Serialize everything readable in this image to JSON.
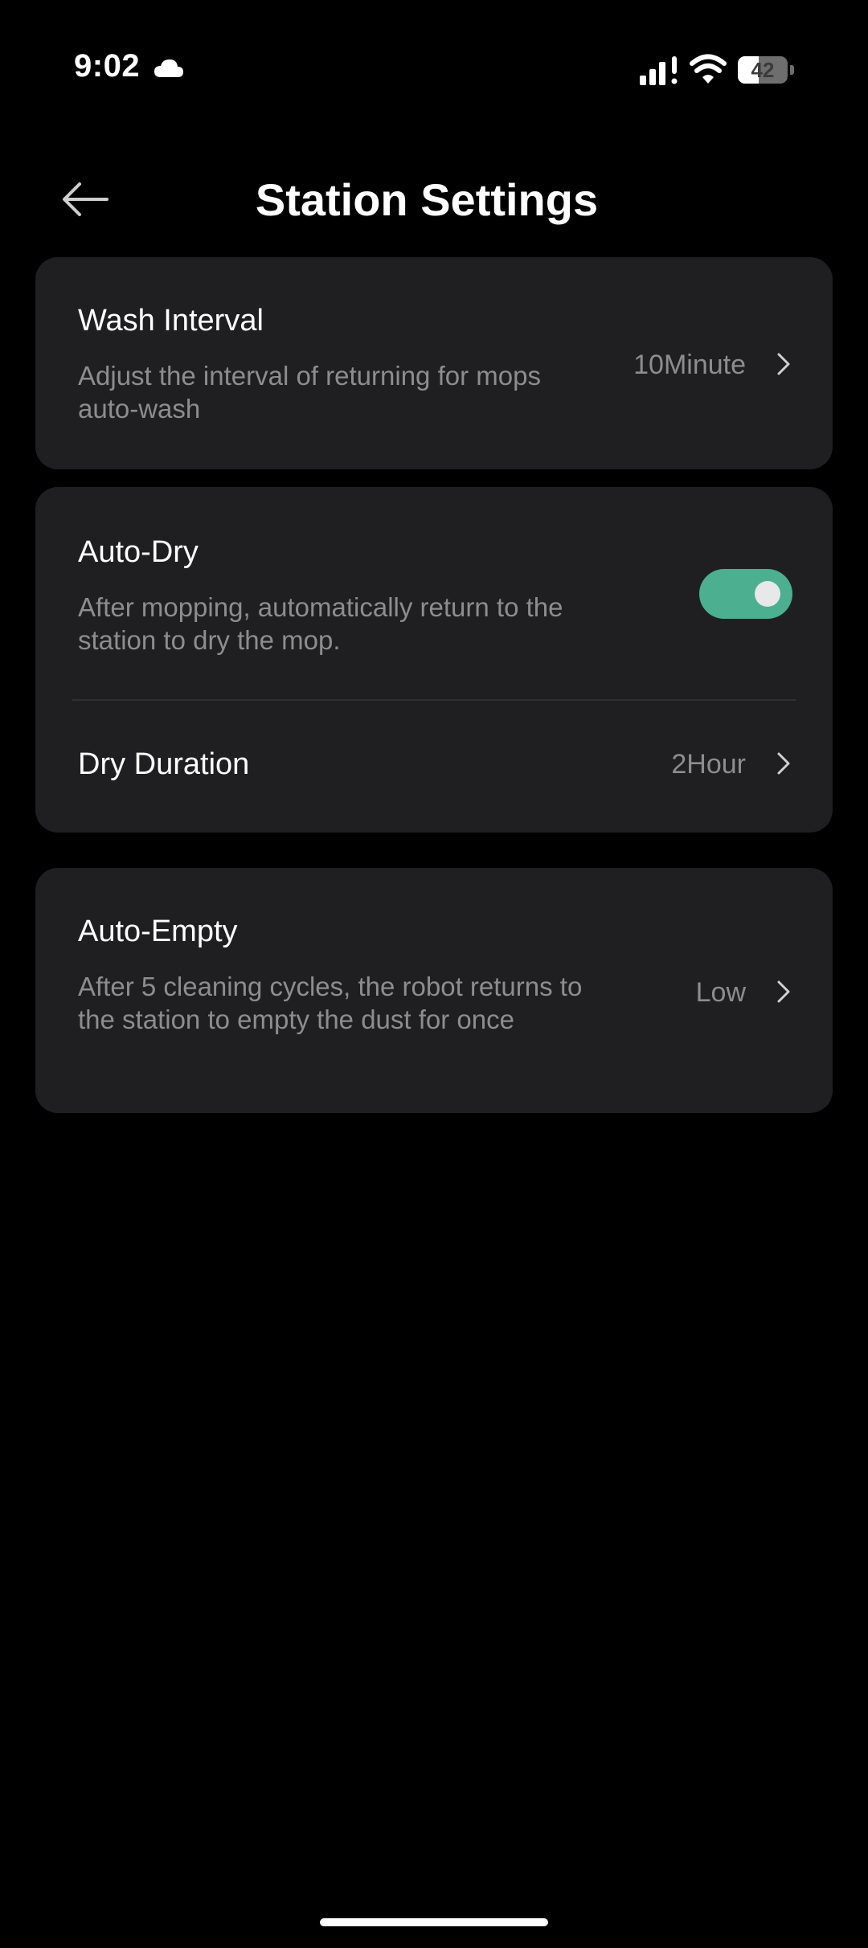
{
  "status_bar": {
    "time": "9:02",
    "battery": "42",
    "battery_level": 0.42,
    "icons": [
      "cloud-icon",
      "signal-icon",
      "wifi-icon",
      "battery-icon"
    ]
  },
  "header": {
    "back_icon": "arrow-left-icon",
    "title": "Station Settings"
  },
  "wash_interval": {
    "title": "Wash Interval",
    "description": "Adjust the interval of returning for mops auto-wash",
    "value": "10Minute"
  },
  "auto_dry": {
    "title": "Auto-Dry",
    "description": "After mopping, automatically return to the  station to dry the mop.",
    "enabled": true
  },
  "dry_duration": {
    "title": "Dry Duration",
    "value": "2Hour"
  },
  "auto_empty": {
    "title": "Auto-Empty",
    "description": "After 5 cleaning cycles, the robot returns to the station to empty the dust for once",
    "value": "Low"
  },
  "colors": {
    "background": "#000000",
    "card": "#1f1f21",
    "secondary_text": "#8d8d8f",
    "toggle_on": "#4caf8f"
  }
}
